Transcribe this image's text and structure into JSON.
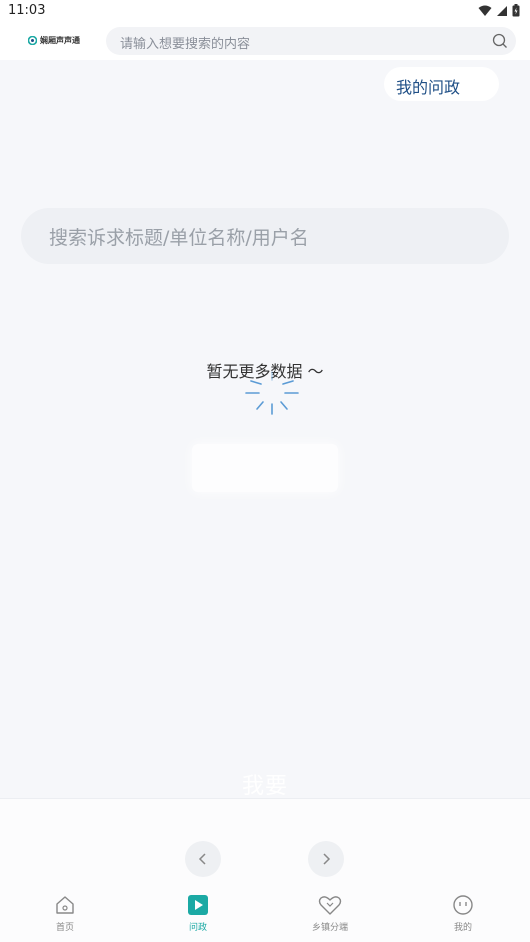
{
  "status_bar": {
    "time": "11:03"
  },
  "header": {
    "logo_text": "娴厢声声通",
    "search_placeholder": "请输入想要搜索的内容"
  },
  "my_wenzheng_label": "我的问政",
  "content_search_placeholder": "搜索诉求标题/单位名称/用户名",
  "empty_message": "暂无更多数据 ～",
  "ghost_label": "我要",
  "colors": {
    "accent": "#1ba9a4",
    "link": "#1f4f86"
  },
  "tabs": [
    {
      "label": "首页",
      "icon": "home-icon",
      "active": false
    },
    {
      "label": "问政",
      "icon": "play-square-icon",
      "active": true
    },
    {
      "label": "乡镇分端",
      "icon": "heart-icon",
      "active": false
    },
    {
      "label": "我的",
      "icon": "face-icon",
      "active": false
    }
  ]
}
